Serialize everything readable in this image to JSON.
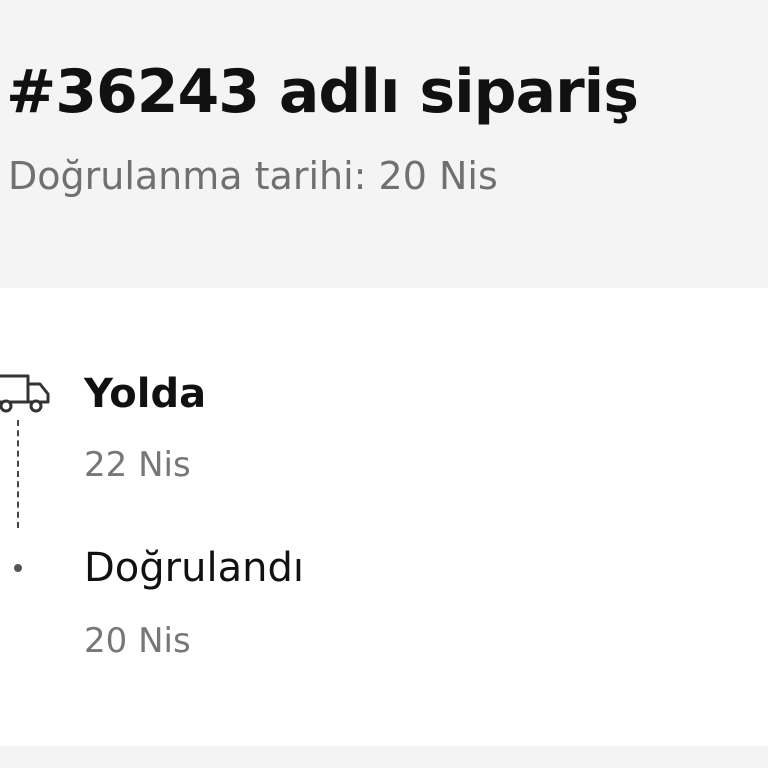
{
  "order": {
    "title": "#36243 adlı sipariş",
    "confirmation_line": "Doğrulanma tarihi: 20 Nis"
  },
  "timeline": {
    "steps": [
      {
        "label": "Yolda",
        "date": "22 Nis",
        "icon": "truck-icon",
        "current": true
      },
      {
        "label": "Doğrulandı",
        "date": "20 Nis",
        "icon": "bullet-dot",
        "current": false
      }
    ]
  },
  "colors": {
    "header_bg": "#f4f4f4",
    "card_bg": "#ffffff",
    "title_text": "#111111",
    "muted_text": "#707070"
  }
}
